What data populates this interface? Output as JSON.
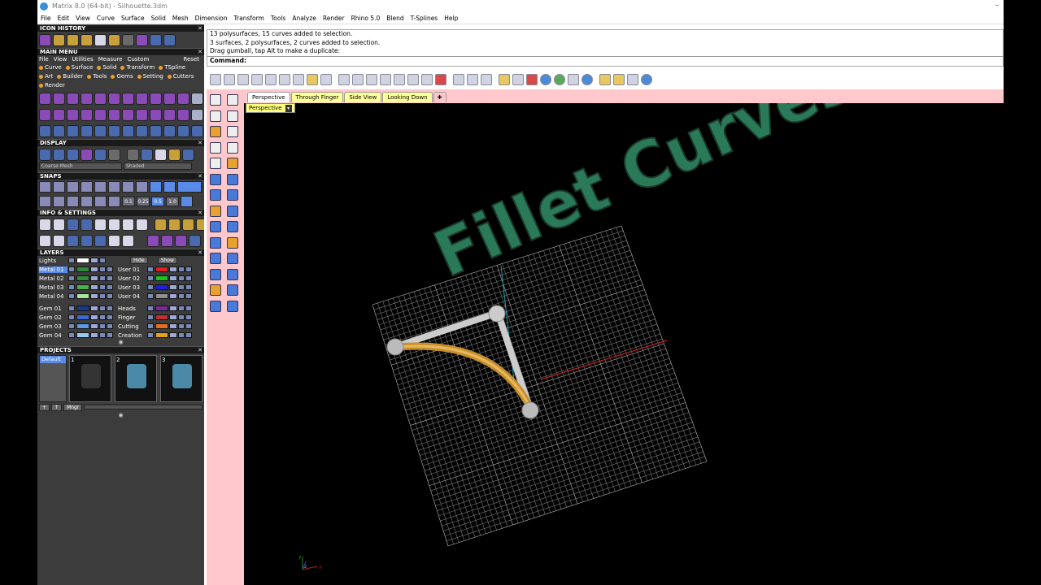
{
  "window": {
    "title": "Matrix 8.0 (64-bit) - Silhouette.3dm",
    "controls": "–"
  },
  "menubar": [
    "File",
    "Edit",
    "View",
    "Curve",
    "Surface",
    "Solid",
    "Mesh",
    "Dimension",
    "Transform",
    "Tools",
    "Analyze",
    "Render",
    "Rhino 5.0",
    "Blend",
    "T-Splines",
    "Help"
  ],
  "panels": {
    "icon_history": "ICON HISTORY",
    "main_menu": "MAIN MENU",
    "display": "DISPLAY",
    "snaps": "SNAPS",
    "info_settings": "INFO & SETTINGS",
    "layers": "LAYERS",
    "projects": "PROJECTS",
    "close": "✕"
  },
  "main_menu": {
    "menus": [
      "File",
      "View",
      "Utilities",
      "Measure",
      "Custom"
    ],
    "reset": "Reset",
    "tabs": [
      "Curve",
      "Surface",
      "Solid",
      "Transform",
      "TSpline",
      "Art",
      "Builder",
      "Tools",
      "Gems",
      "Setting",
      "Cutters",
      "Render"
    ]
  },
  "display": {
    "mesh_select": "Coarse Mesh",
    "mode_select": "Shaded"
  },
  "snaps": {
    "values": [
      "0.1",
      "0.25",
      "0.5",
      "1.0"
    ]
  },
  "layers": {
    "header_left": "Lights",
    "hide_label": "Hide",
    "show_label": "Show",
    "left": [
      {
        "name": "Metal 01",
        "color": "#2e8b3a"
      },
      {
        "name": "Metal 02",
        "color": "#2e8b3a"
      },
      {
        "name": "Metal 03",
        "color": "#4caf50"
      },
      {
        "name": "Metal 04",
        "color": "#a8e6a0"
      },
      {
        "name": "Gem 01",
        "color": "#1a3a8a"
      },
      {
        "name": "Gem 02",
        "color": "#3a6ad8"
      },
      {
        "name": "Gem 03",
        "color": "#5a9ae8"
      },
      {
        "name": "Gem 04",
        "color": "#9ac8f0"
      }
    ],
    "right": [
      {
        "name": "User 01",
        "color": "#e02020"
      },
      {
        "name": "User 02",
        "color": "#20c020"
      },
      {
        "name": "User 03",
        "color": "#2020e0"
      },
      {
        "name": "User 04",
        "color": "#909090"
      },
      {
        "name": "Heads",
        "color": "#7a2a9a"
      },
      {
        "name": "Finger",
        "color": "#c03030"
      },
      {
        "name": "Cutting",
        "color": "#e07020"
      },
      {
        "name": "Creation",
        "color": "#e0a020"
      }
    ]
  },
  "projects": {
    "list": [
      "Default"
    ],
    "thumbs": [
      "1",
      "2",
      "3"
    ],
    "mngr": "Mngr",
    "add": "+",
    "up": "↑"
  },
  "command": {
    "history": [
      "13 polysurfaces, 15 curves added to selection.",
      "3 surfaces, 2 polysurfaces, 2 curves added to selection.",
      "Drag gumball, tap Alt to make a duplicate:"
    ],
    "prompt": "Command:"
  },
  "viewport_tabs": [
    "Perspective",
    "Through Finger",
    "Side View",
    "Looking Down"
  ],
  "viewport": {
    "label": "Perspective",
    "overlay_text": "Fillet Curves",
    "accent": "#2a7a5a",
    "axis_labels": [
      "y",
      "z",
      "x"
    ]
  }
}
